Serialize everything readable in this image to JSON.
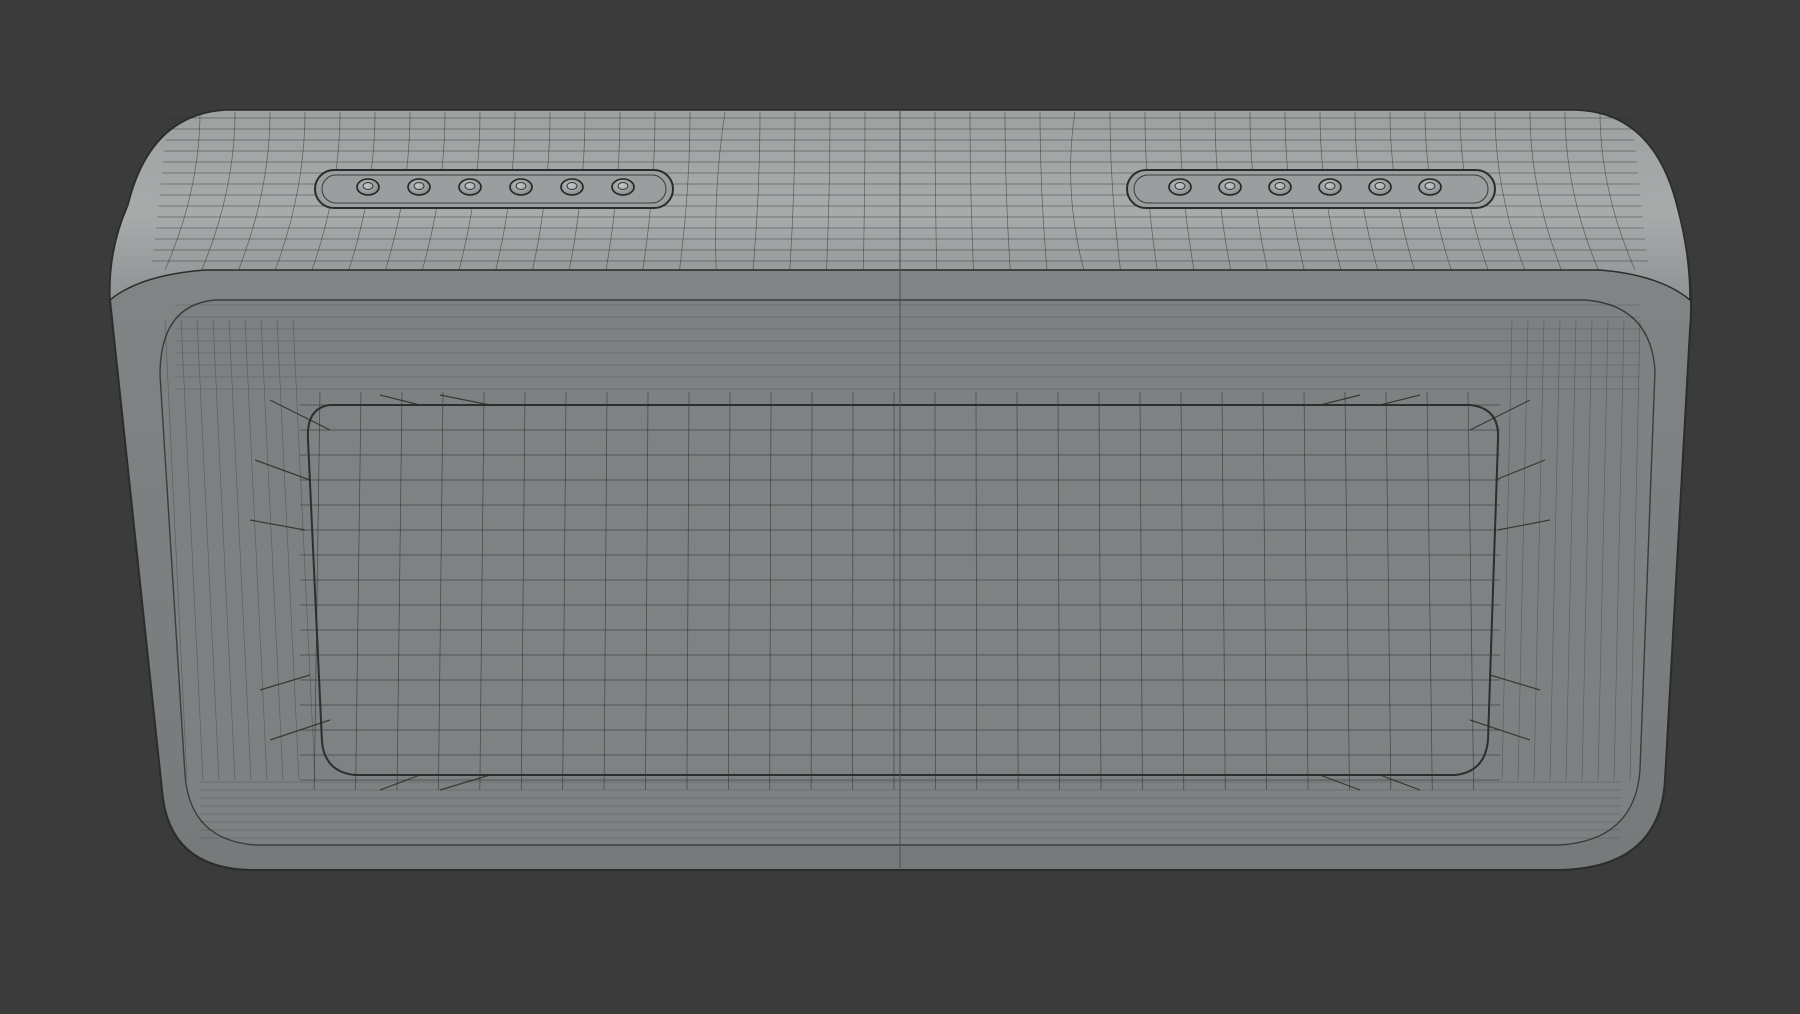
{
  "viewport": {
    "background": "#3b3b3b",
    "object": "speaker-wireframe-model",
    "shading": "solid-with-wireframe",
    "colors": {
      "surface_top": "#a3a6a6",
      "surface_front": "#7f8383",
      "surface_dark": "#6f7373",
      "wire": "#2b2e2e",
      "edge_highlight": "#b7baba"
    },
    "top_buttons_per_group": 6,
    "button_groups": 2
  }
}
